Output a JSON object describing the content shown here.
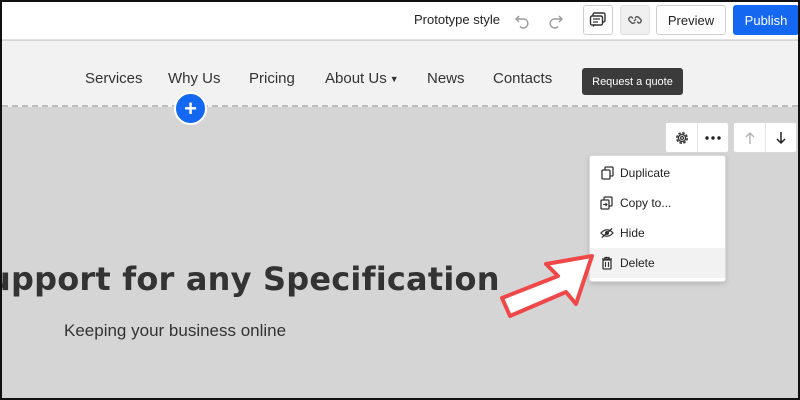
{
  "toolbar": {
    "prototype_style": "Prototype style",
    "preview_label": "Preview",
    "publish_label": "Publish"
  },
  "nav": {
    "items": [
      {
        "label": "Services"
      },
      {
        "label": "Why Us"
      },
      {
        "label": "Pricing"
      },
      {
        "label": "About Us",
        "has_dropdown": true
      },
      {
        "label": "News"
      },
      {
        "label": "Contacts"
      }
    ],
    "quote_button": "Request a quote"
  },
  "add_section": {
    "icon": "plus-icon"
  },
  "section_controls": {
    "settings_icon": "gear-icon",
    "more_icon": "more-horizontal-icon",
    "move_up_icon": "arrow-up-icon",
    "move_down_icon": "arrow-down-icon"
  },
  "menu": {
    "items": [
      {
        "label": "Duplicate",
        "icon": "duplicate-icon"
      },
      {
        "label": "Copy to...",
        "icon": "copy-to-icon"
      },
      {
        "label": "Hide",
        "icon": "eye-off-icon"
      },
      {
        "label": "Delete",
        "icon": "trash-icon",
        "highlighted": true
      }
    ]
  },
  "hero": {
    "title": "upport for any Specification",
    "subtitle": "Keeping your business online"
  },
  "colors": {
    "accent": "#1467f0",
    "arrow": "#f04848",
    "canvas": "#d5d5d5"
  }
}
